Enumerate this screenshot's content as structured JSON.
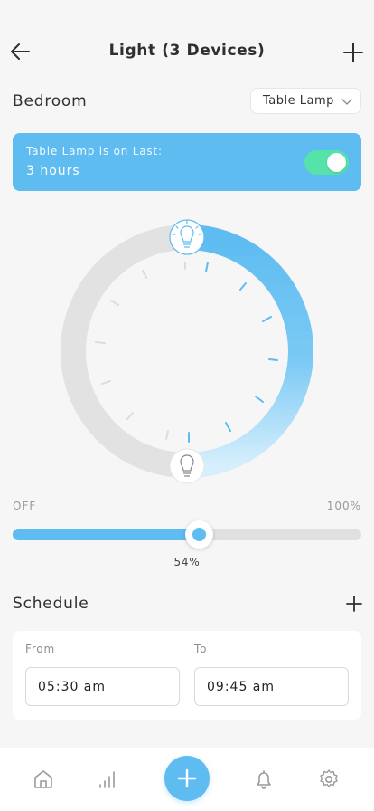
{
  "header": {
    "title": "Light (3 Devices)",
    "back_icon": "arrow-left-icon",
    "add_icon": "plus-icon"
  },
  "room": {
    "name": "Bedroom",
    "device_selected": "Table Lamp",
    "dropdown_icon": "chevron-down-icon"
  },
  "status": {
    "label": "Table Lamp is on Last:",
    "value": "3 hours",
    "toggle_on": true
  },
  "dial": {
    "level_percent": 54,
    "top_icon": "bulb-on-icon",
    "bottom_icon": "bulb-off-icon"
  },
  "brightness": {
    "min_label": "OFF",
    "max_label": "100%",
    "value": 54,
    "value_label": "54%"
  },
  "schedule": {
    "title": "Schedule",
    "add_icon": "plus-icon",
    "from_label": "From",
    "from_value": "05:30 am",
    "to_label": "To",
    "to_value": "09:45 am"
  },
  "nav": {
    "items": [
      {
        "icon": "home-icon"
      },
      {
        "icon": "stats-icon"
      },
      {
        "icon": "plus-icon"
      },
      {
        "icon": "bell-icon"
      },
      {
        "icon": "gear-icon"
      }
    ]
  },
  "colors": {
    "accent": "#5ebcf1",
    "accent_light": "#c5e9fb",
    "toggle_on": "#55e3a9",
    "track": "#e0e0e0",
    "background": "#f6f6f6"
  }
}
